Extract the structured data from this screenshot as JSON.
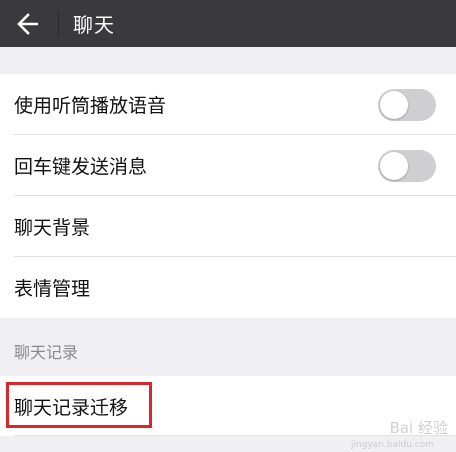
{
  "header": {
    "title": "聊天",
    "back_icon": "arrow-left-icon"
  },
  "settings": [
    {
      "label": "使用听筒播放语音",
      "toggle": "off"
    },
    {
      "label": "回车键发送消息",
      "toggle": "off"
    },
    {
      "label": "聊天背景"
    },
    {
      "label": "表情管理"
    }
  ],
  "chat_history": {
    "section_title": "聊天记录",
    "items": [
      {
        "label": "聊天记录迁移",
        "highlighted": true
      }
    ]
  },
  "watermark": {
    "text": "Bai 经验",
    "sub": "jingyan.baidu.com"
  },
  "colors": {
    "topbar": "#3a3a3c",
    "background": "#efeff4",
    "highlight": "#d8282c",
    "toggle_off": "#cfcfd2"
  }
}
